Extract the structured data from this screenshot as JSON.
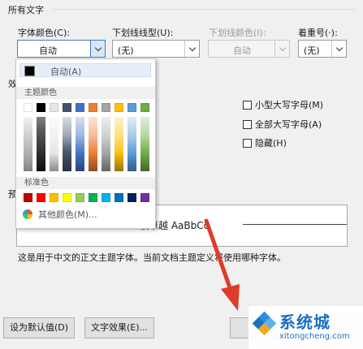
{
  "section": {
    "all_text": "所有文字"
  },
  "labels": {
    "font_color": "字体颜色(C):",
    "underline_type": "下划线线型(U):",
    "underline_color": "下划线颜色(I):",
    "emphasis": "着重号(·):"
  },
  "combos": {
    "font_color": "自动",
    "underline_type": "(无)",
    "underline_color": "自动",
    "emphasis": "(无)"
  },
  "partial_labels": {
    "effects_prefix": "效",
    "preview_prefix": "预"
  },
  "checkboxes": {
    "small_caps": "小型大写字母(M)",
    "all_caps": "全部大写字母(A)",
    "hidden": "隐藏(H)"
  },
  "color_menu": {
    "auto_label": "自动(A)",
    "theme_colors_label": "主题颜色",
    "standard_colors_label": "标准色",
    "more_colors_label": "其他颜色(M)...",
    "theme_colors": [
      "#ffffff",
      "#000000",
      "#e7e6e6",
      "#44546a",
      "#4472c4",
      "#ed7d31",
      "#a5a5a5",
      "#ffc000",
      "#5b9bd5",
      "#70ad47"
    ],
    "standard_colors": [
      "#c00000",
      "#ff0000",
      "#ffc000",
      "#ffff00",
      "#92d050",
      "#00b050",
      "#00b0f0",
      "#0070c0",
      "#002060",
      "#7030a0"
    ]
  },
  "preview": {
    "text": "软卓越 AaBbCc",
    "note": "这是用于中文的正文主题字体。当前文档主题定义将使用哪种字体。"
  },
  "buttons": {
    "set_default": "设为默认值(D)",
    "text_effects": "文字效果(E)..."
  },
  "watermark": {
    "name": "系统城",
    "url": "xitongcheng.com"
  },
  "colors": {
    "accent": "#1d6fc2",
    "arrow": "#e03a2a",
    "focus": "#3c7fc1"
  }
}
